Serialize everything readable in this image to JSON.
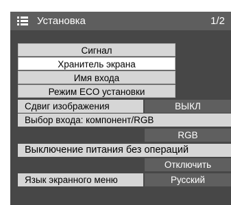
{
  "header": {
    "title": "Установка",
    "page": "1/2"
  },
  "submenus": [
    {
      "label": "Сигнал"
    },
    {
      "label": "Хранитель экрана",
      "selected": true
    },
    {
      "label": "Имя входа"
    },
    {
      "label": "Режим ECO установки"
    }
  ],
  "settings": {
    "image_shift": {
      "label": "Сдвиг изображения",
      "value": "ВЫКЛ"
    },
    "input_select": {
      "label": "Выбор входа: компонент/RGB",
      "value": "RGB"
    },
    "no_activity_power_off": {
      "label": "Выключение питания без операций",
      "value": "Отключить"
    },
    "osd_language": {
      "label": "Язык экранного меню",
      "value": "Русский"
    }
  },
  "colors": {
    "frame": "#474747",
    "header": "#5e5e5e",
    "button": "#d6d6d6",
    "selected": "#ffffff",
    "value_cell": "#5f5f5f"
  }
}
